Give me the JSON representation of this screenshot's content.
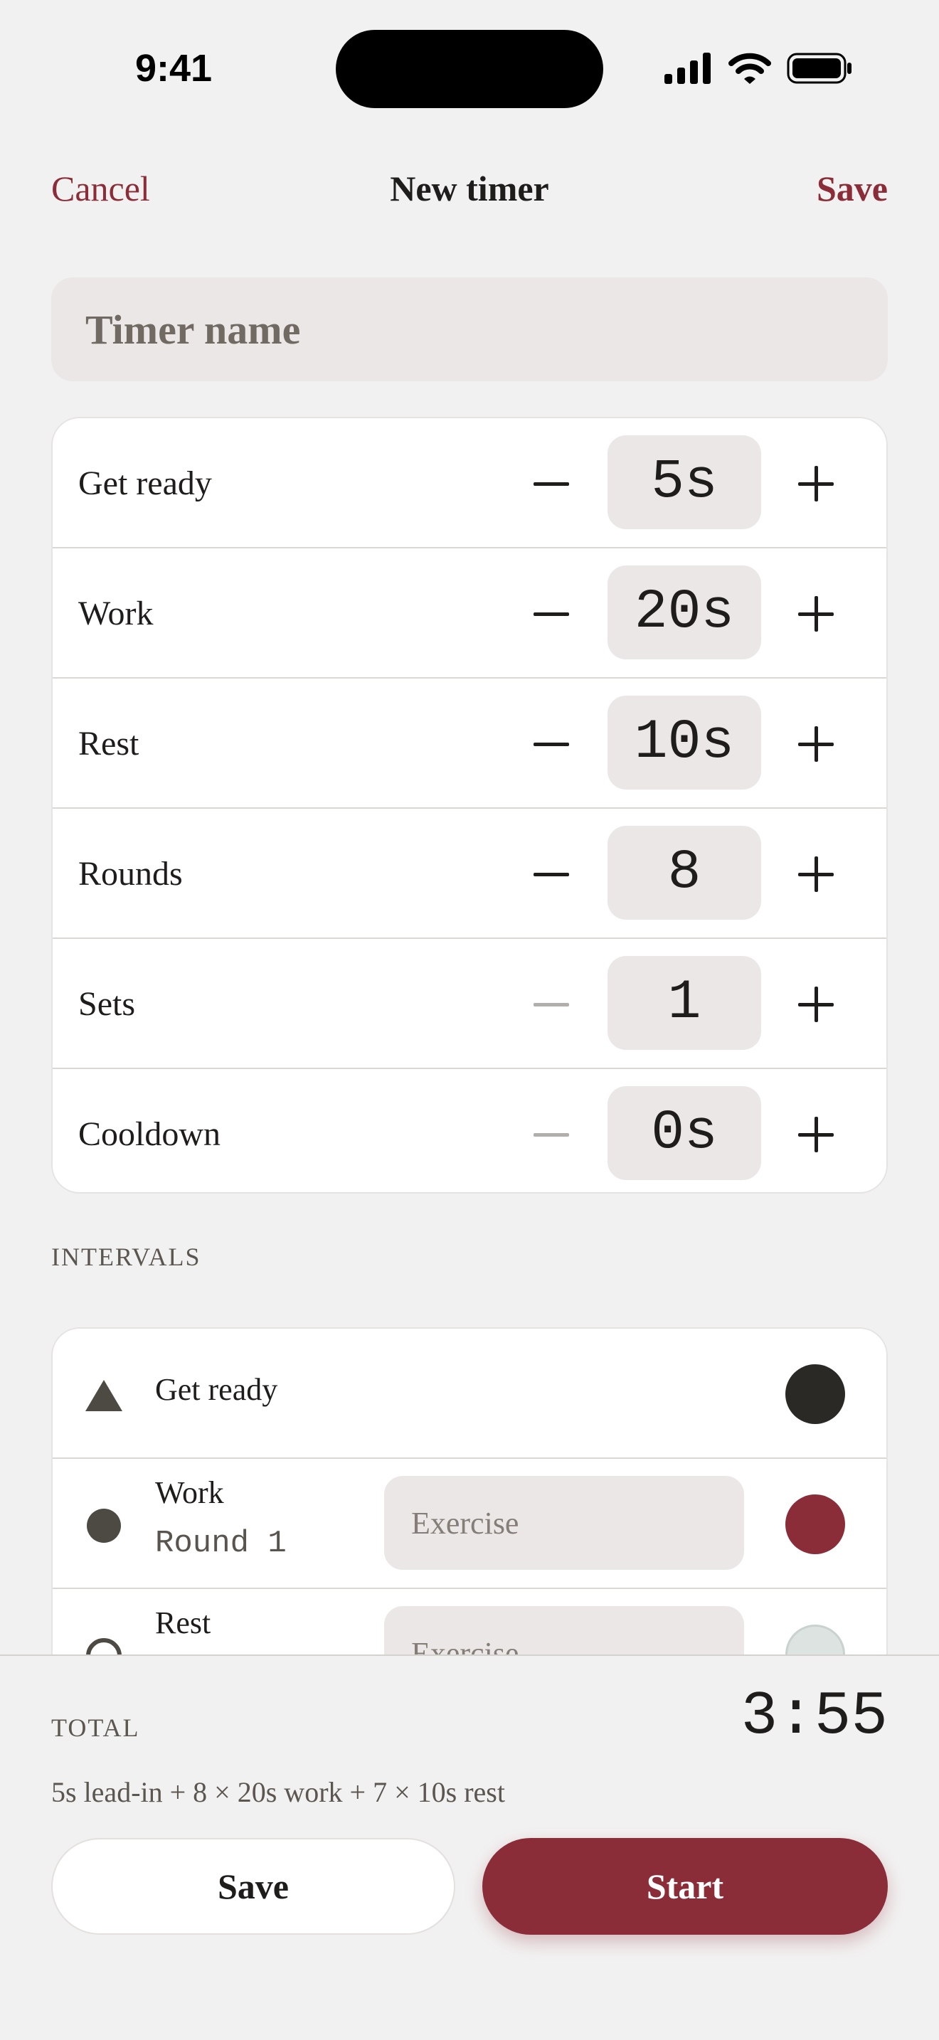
{
  "status_bar": {
    "time": "9:41",
    "icons": [
      "cellular-icon",
      "wifi-icon",
      "battery-icon"
    ]
  },
  "nav": {
    "cancel": "Cancel",
    "title": "New timer",
    "save": "Save"
  },
  "name_field": {
    "placeholder": "Timer name",
    "value": ""
  },
  "settings": [
    {
      "label": "Get ready",
      "value": "5s",
      "minus_enabled": true
    },
    {
      "label": "Work",
      "value": "20s",
      "minus_enabled": true
    },
    {
      "label": "Rest",
      "value": "10s",
      "minus_enabled": true
    },
    {
      "label": "Rounds",
      "value": "8",
      "minus_enabled": true
    },
    {
      "label": "Sets",
      "value": "1",
      "minus_enabled": false
    },
    {
      "label": "Cooldown",
      "value": "0s",
      "minus_enabled": false
    }
  ],
  "intervals": {
    "section_label": "INTERVALS",
    "items": [
      {
        "name": "Get ready",
        "shape": "triangle-icon",
        "color": "#2a2925"
      },
      {
        "name": "Work",
        "sub": "Round 1",
        "shape": "filled-circle-icon",
        "exercise_placeholder": "Exercise",
        "color": "#8b2d39"
      },
      {
        "name": "Rest",
        "shape": "hollow-circle-icon",
        "exercise_placeholder": "Exercise",
        "color": "#dde3e1"
      }
    ]
  },
  "summary": {
    "total_label": "TOTAL",
    "total_value": "3:55",
    "breakdown": "5s lead-in + 8 × 20s work + 7 × 10s rest",
    "save_label": "Save",
    "start_label": "Start"
  },
  "colors": {
    "accent": "#8b2d39",
    "background": "#f2f1f1",
    "field": "#ebe7e6"
  }
}
